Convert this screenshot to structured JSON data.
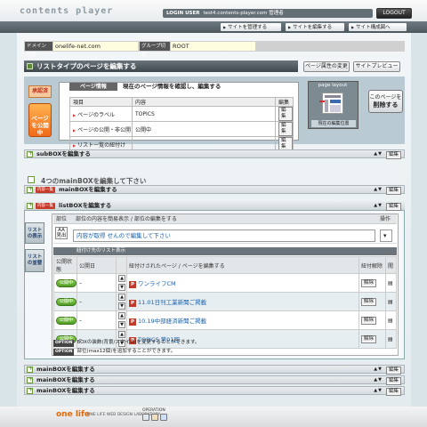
{
  "header": {
    "logo": "contents player",
    "login_label": "LOGIN USER",
    "login_value": "test4.contents-player.com 管理者",
    "logout": "LOGOUT"
  },
  "nav": {
    "items": [
      "サイトを管理する",
      "サイトを編集する",
      "サイト構成図へ"
    ]
  },
  "domain": {
    "domain_label": "ドメイン切替",
    "domain_value": "onelife-net.com",
    "group_label": "グループ切替",
    "group_value": "ROOT"
  },
  "list": {
    "title": "リストタイプのページを編集する",
    "attr_button": "ページ属性の変更",
    "preview_button": "サイトプレビュー"
  },
  "badges": {
    "approval": "承認済",
    "public": "ページを公開中"
  },
  "page_info": {
    "tab": "ページ情報",
    "desc": "現在のページ情報を確認し、編集する",
    "col_item": "項目",
    "col_content": "内容",
    "col_edit": "編集",
    "rows": [
      {
        "item": "ページのラベル",
        "content": "TOPICS",
        "edit": "編集"
      },
      {
        "item": "ページの公開・非公開",
        "content": "公開中",
        "edit": "編集"
      },
      {
        "item": "リスト一覧の紐付け",
        "content": "",
        "edit": "編集"
      }
    ]
  },
  "page_layout": {
    "title": "page layout",
    "label": "現在の編集位置"
  },
  "delete_button": {
    "line1": "このページを",
    "line2": "削除する"
  },
  "subbox": {
    "title": "subBOXを編集する",
    "edit": "編集"
  },
  "guide": "4つのmainBOXを編集して下さい",
  "mainbox": {
    "badge": "内容一覧",
    "title": "mainBOXを編集する",
    "edit": "編集"
  },
  "listbox": {
    "badge": "内容一覧",
    "title": "listBOXを編集する",
    "edit": "編集"
  },
  "side": {
    "b1": "リストの表示",
    "b2": "リストの並替"
  },
  "parts": {
    "col_part": "部位",
    "col_desc": "部位の内容を簡易表示 / 部位の編集をする",
    "col_op": "操作",
    "aa_label": "AA 見出",
    "mix_text": "内容が取得 せんので編集して下さい"
  },
  "sub_list": {
    "label": "紐付け先のリスト表示",
    "col_status": "公開状態",
    "col_date": "公開日",
    "col_page": "紐付けされたページ / ページを編集する",
    "col_release": "紐付解除",
    "col_x": "閲",
    "rows": [
      {
        "status": "公開中",
        "date": "–",
        "title": "ワンライフCM",
        "release": "解除"
      },
      {
        "status": "公開中",
        "date": "–",
        "title": "11.01日刊工業新聞ご掲載",
        "release": "解除"
      },
      {
        "status": "公開中",
        "date": "–",
        "title": "10.19中部経済新聞ご掲載",
        "release": "解除"
      },
      {
        "status": "公開中",
        "date": "–",
        "title": "TOPICS 第01回",
        "release": "解除"
      }
    ]
  },
  "options": {
    "tag": "OPTION",
    "o1": "BOXの装飾(背景/スタイル)を変更することができます。",
    "o2": "部位(max12個)を追加することができます。"
  },
  "footer": {
    "logo": "one life",
    "lab": "ONE LIFE WEB DESIGN LABORATORY",
    "op": "OPERATION"
  }
}
